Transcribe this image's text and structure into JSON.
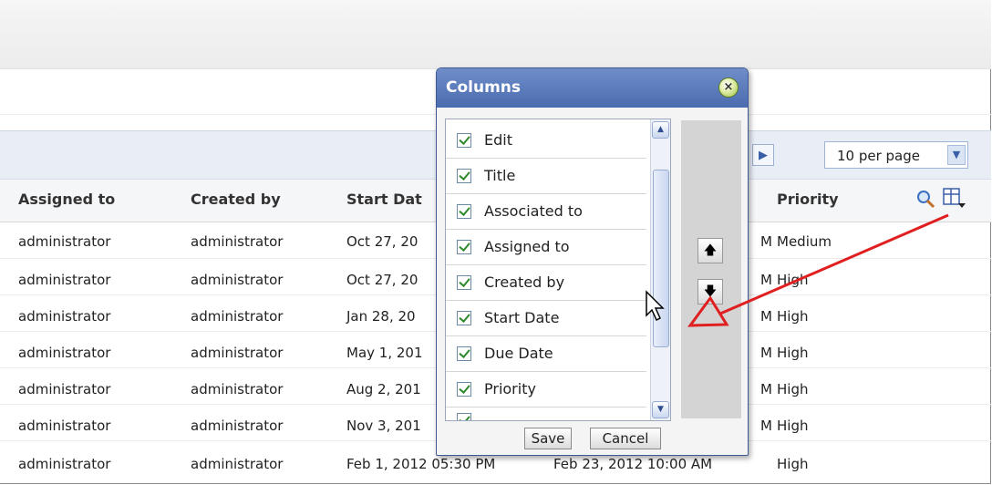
{
  "grid": {
    "headers": {
      "assigned_to": "Assigned to",
      "created_by": "Created by",
      "start_date": "Start Dat",
      "priority": "Priority"
    },
    "rows": [
      {
        "assigned": "administrator",
        "created": "administrator",
        "start": "Oct 27, 20",
        "due": "M",
        "priority": "Medium"
      },
      {
        "assigned": "administrator",
        "created": "administrator",
        "start": "Oct 27, 20",
        "due": "M",
        "priority": "High"
      },
      {
        "assigned": "administrator",
        "created": "administrator",
        "start": "Jan 28, 20",
        "due": "M",
        "priority": "High"
      },
      {
        "assigned": "administrator",
        "created": "administrator",
        "start": "May 1, 201",
        "due": "M",
        "priority": "High"
      },
      {
        "assigned": "administrator",
        "created": "administrator",
        "start": "Aug 2, 201",
        "due": "M",
        "priority": "High"
      },
      {
        "assigned": "administrator",
        "created": "administrator",
        "start": "Nov 3, 201",
        "due": "M",
        "priority": "High"
      },
      {
        "assigned": "administrator",
        "created": "administrator",
        "start": "Feb 1, 2012 05:30 PM",
        "due": "Feb 23, 2012 10:00 AM",
        "priority": "High"
      }
    ]
  },
  "pager": {
    "per_page": "10 per page"
  },
  "dialog": {
    "title": "Columns",
    "items": [
      "Edit",
      "Title",
      "Associated to",
      "Assigned to",
      "Created by",
      "Start Date",
      "Due Date",
      "Priority"
    ],
    "save_label": "Save",
    "cancel_label": "Cancel"
  },
  "colors": {
    "title_bar": "#5576b9",
    "annotation_arrow": "#e02020",
    "toolbar": "#e9eef6"
  }
}
